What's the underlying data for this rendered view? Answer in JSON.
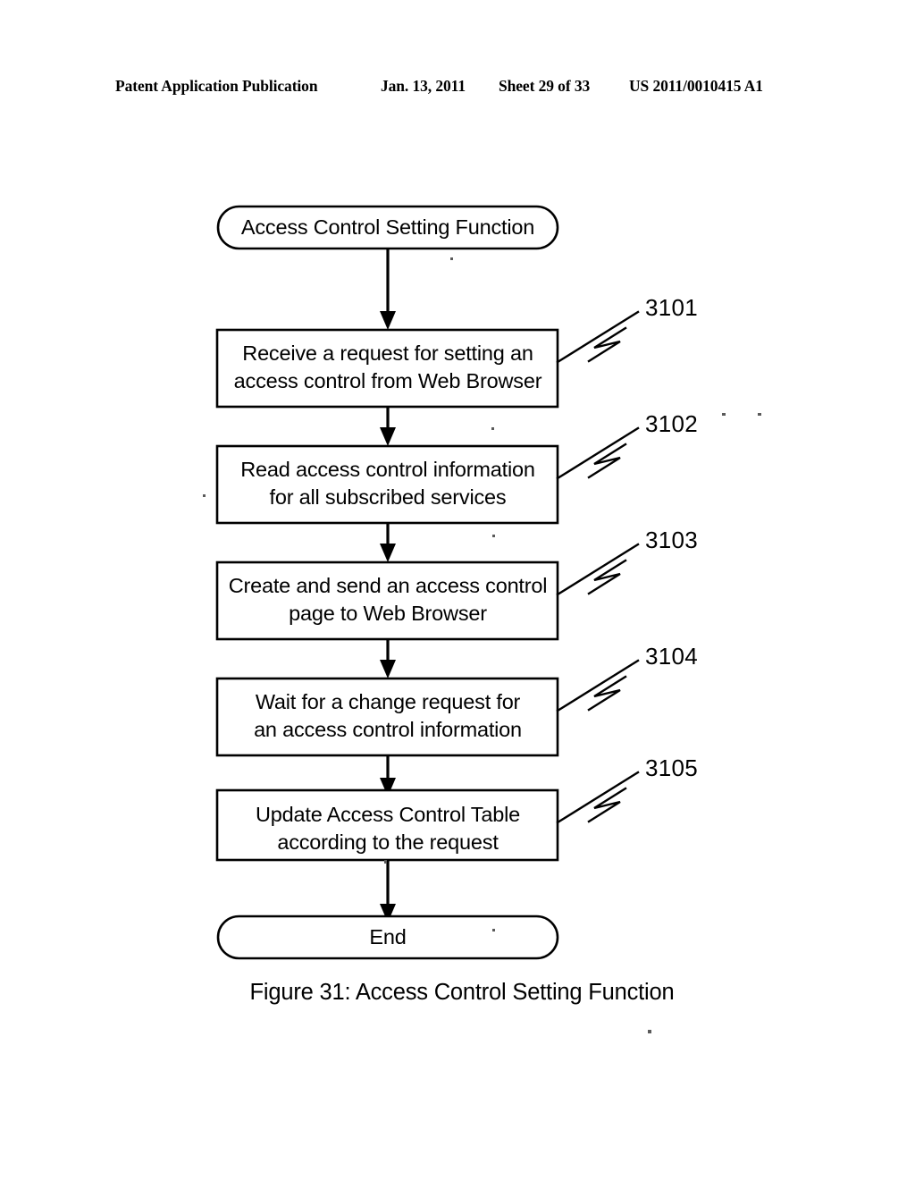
{
  "header": {
    "publication": "Patent Application Publication",
    "date": "Jan. 13, 2011",
    "sheet": "Sheet 29 of 33",
    "patent_number": "US 2011/0010415 A1"
  },
  "figure": {
    "caption": "Figure 31: Access Control Setting Function",
    "start_label": "Access Control Setting Function",
    "end_label": "End",
    "steps": [
      {
        "numeral": "3101",
        "line1": "Receive a request for setting an",
        "line2": "access control from Web Browser"
      },
      {
        "numeral": "3102",
        "line1": "Read access control information",
        "line2": "for all subscribed services"
      },
      {
        "numeral": "3103",
        "line1": "Create and send an access control",
        "line2": "page to Web Browser"
      },
      {
        "numeral": "3104",
        "line1": "Wait for a change request for",
        "line2": "an access control information"
      },
      {
        "numeral": "3105",
        "line1": "Update Access Control Table",
        "line2": "according to the request"
      }
    ]
  },
  "colors": {
    "ink": "#000000",
    "paper": "#ffffff"
  }
}
